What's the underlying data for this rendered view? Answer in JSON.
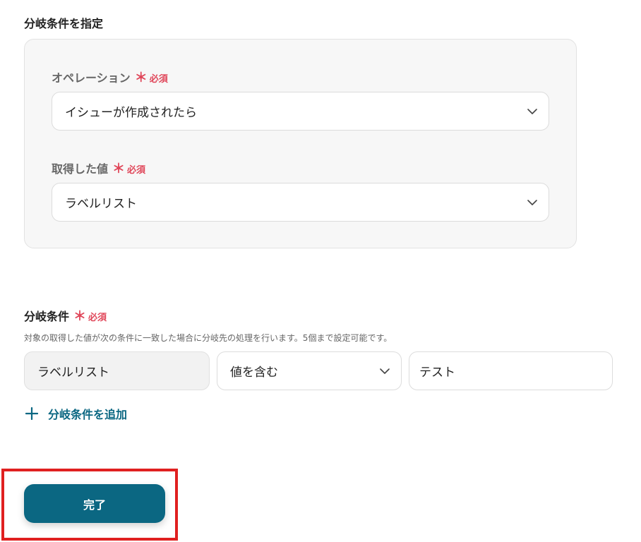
{
  "branch_spec": {
    "title": "分岐条件を指定",
    "operation": {
      "label": "オペレーション",
      "required_mark": "＊",
      "required_text": "必須",
      "value": "イシューが作成されたら"
    },
    "acquired_value": {
      "label": "取得した値",
      "required_mark": "＊",
      "required_text": "必須",
      "value": "ラベルリスト"
    }
  },
  "branch_condition": {
    "title": "分岐条件",
    "required_mark": "＊",
    "required_text": "必須",
    "description": "対象の取得した値が次の条件に一致した場合に分岐先の処理を行います。5個まで設定可能です。",
    "row": {
      "target": "ラベルリスト",
      "operator": "値を含む",
      "value": "テスト"
    },
    "add_label": "分岐条件を追加"
  },
  "done_button": {
    "label": "完了"
  },
  "colors": {
    "primary": "#0b6782",
    "required": "#e0475a",
    "highlight": "#e02020"
  }
}
